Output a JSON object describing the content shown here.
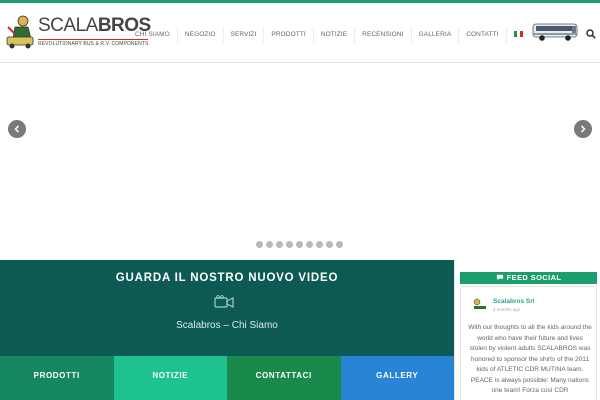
{
  "header": {
    "logo": {
      "brand_light": "SCALA",
      "brand_bold": "BROS",
      "tagline": "REVOLUTIONARY BUS & R.V. COMPONENTS"
    },
    "nav": [
      {
        "label": "Chi Siamo"
      },
      {
        "label": "Negozio"
      },
      {
        "label": "Servizi"
      },
      {
        "label": "Prodotti"
      },
      {
        "label": "Notizie"
      },
      {
        "label": "Recensioni"
      },
      {
        "label": "Galleria"
      },
      {
        "label": "Contatti"
      }
    ],
    "language_flag": "italy-flag-icon",
    "search_icon": "search-icon"
  },
  "slider": {
    "prev_icon": "chevron-left-icon",
    "next_icon": "chevron-right-icon",
    "slide_count": 9
  },
  "video": {
    "title": "GUARDA IL NOSTRO NUOVO VIDEO",
    "icon": "video-camera-icon",
    "subtitle": "Scalabros – Chi Siamo"
  },
  "ctas": [
    {
      "label": "PRODOTTI",
      "color": "#16875f"
    },
    {
      "label": "NOTIZIE",
      "color": "#1dc290"
    },
    {
      "label": "CONTATTACI",
      "color": "#1a8a4a"
    },
    {
      "label": "GALLERY",
      "color": "#2a84d6"
    }
  ],
  "feed": {
    "heading": "FEED SOCIAL",
    "icon": "comment-icon",
    "post": {
      "author": "Scalabros Srl",
      "time": "4 months ago",
      "text": "With our thoughts to all the kids around the world who have their future and lives stolen by violent adults SCALABROS was honored to sponsor the shirts of the 2011 kids of ATLETIC CDR MUTINA team. PEACE is always possible: Many nations one team! Forza così CDR"
    }
  },
  "colors": {
    "accent": "#1b9e6e",
    "video_bg": "#0d5954"
  }
}
